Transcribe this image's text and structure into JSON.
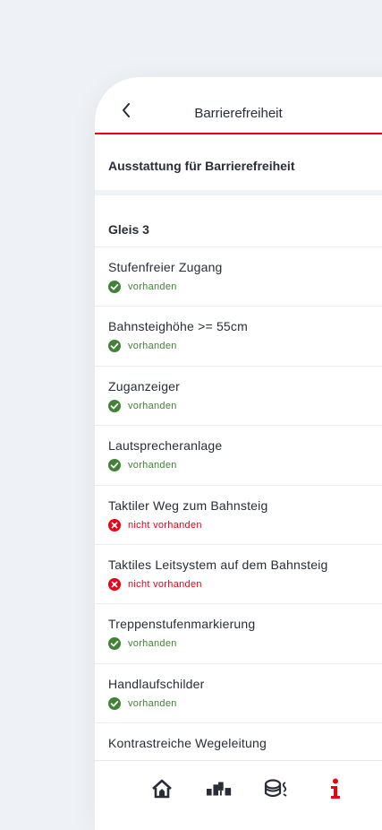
{
  "header": {
    "title": "Barrierefreiheit"
  },
  "section": {
    "title": "Ausstattung für Barrierefreiheit"
  },
  "platform": {
    "title": "Gleis 3"
  },
  "items": [
    {
      "label": "Stufenfreier Zugang",
      "status": "vorhanden",
      "available": true
    },
    {
      "label": "Bahnsteighöhe >= 55cm",
      "status": "vorhanden",
      "available": true
    },
    {
      "label": "Zuganzeiger",
      "status": "vorhanden",
      "available": true
    },
    {
      "label": "Lautsprecheranlage",
      "status": "vorhanden",
      "available": true
    },
    {
      "label": "Taktiler Weg zum Bahnsteig",
      "status": "nicht vorhanden",
      "available": false
    },
    {
      "label": "Taktiles Leitsystem auf dem Bahnsteig",
      "status": "nicht vorhanden",
      "available": false
    },
    {
      "label": "Treppenstufenmarkierung",
      "status": "vorhanden",
      "available": true
    },
    {
      "label": "Handlaufschilder",
      "status": "vorhanden",
      "available": true
    },
    {
      "label": "Kontrastreiche Wegeleitung",
      "status": "",
      "available": true
    }
  ],
  "nav": [
    {
      "icon": "home-icon",
      "active": false
    },
    {
      "icon": "station-icon",
      "active": false
    },
    {
      "icon": "travel-center-icon",
      "active": false
    },
    {
      "icon": "info-icon",
      "active": true
    }
  ],
  "colors": {
    "accent": "#ec0016",
    "ok": "#408335",
    "text": "#282d37"
  }
}
